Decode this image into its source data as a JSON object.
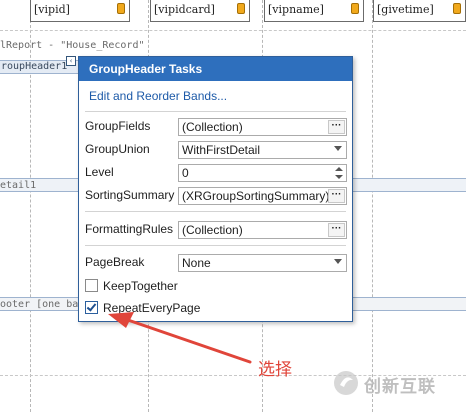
{
  "report": {
    "fields": [
      "[vipid]",
      "[vipidcard]",
      "[vipname]",
      "[givetime]"
    ],
    "report_caption": "lReport - \"House_Record\"",
    "group_header_band": "roupHeader1",
    "detail_band": "etail1",
    "footer_band": "ooter [one ba"
  },
  "panel": {
    "title": "GroupHeader Tasks",
    "link": "Edit and Reorder Bands...",
    "rows": {
      "group_fields": {
        "label": "GroupFields",
        "value": "(Collection)"
      },
      "group_union": {
        "label": "GroupUnion",
        "value": "WithFirstDetail"
      },
      "level": {
        "label": "Level",
        "value": "0"
      },
      "sorting_summary": {
        "label": "SortingSummary",
        "value": "(XRGroupSortingSummary)"
      },
      "formatting_rules": {
        "label": "FormattingRules",
        "value": "(Collection)"
      },
      "page_break": {
        "label": "PageBreak",
        "value": "None"
      }
    },
    "keep_together": {
      "label": "KeepTogether",
      "checked": false
    },
    "repeat_every_page": {
      "label": "RepeatEveryPage",
      "checked": true
    },
    "ellipsis": "···"
  },
  "annotation": {
    "text": "选择",
    "color": "#e0453a"
  },
  "watermark": {
    "text": "创新互联"
  },
  "colors": {
    "header": "#2e6fbd",
    "link": "#1d5aa8",
    "border": "#2f5f9a"
  }
}
